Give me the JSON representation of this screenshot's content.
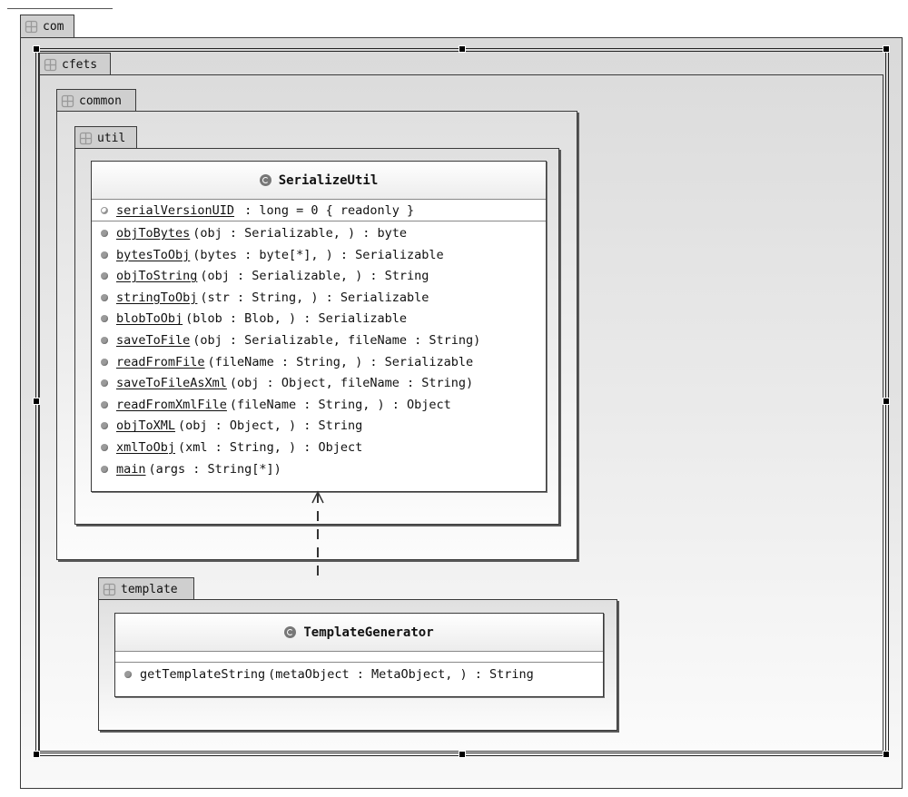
{
  "diagram": {
    "type": "UML package/class diagram",
    "packages": [
      {
        "id": "com",
        "label": "com",
        "icon": "package-icon"
      },
      {
        "id": "cfets",
        "label": "cfets",
        "icon": "package-icon",
        "selected": true
      },
      {
        "id": "common",
        "label": "common",
        "icon": "package-icon"
      },
      {
        "id": "util",
        "label": "util",
        "icon": "package-icon"
      },
      {
        "id": "template",
        "label": "template",
        "icon": "package-icon"
      }
    ],
    "classes": {
      "serialize_util": {
        "name": "SerializeUtil",
        "icon": "class-icon",
        "attributes": [
          {
            "name": "serialVersionUID",
            "signature": " : long = 0 { readonly }",
            "static": true,
            "visibility": "private-icon"
          }
        ],
        "operations": [
          {
            "name": "objToBytes",
            "signature": "(obj : Serializable, ) : byte",
            "static": true
          },
          {
            "name": "bytesToObj",
            "signature": "(bytes : byte[*], ) : Serializable",
            "static": true
          },
          {
            "name": "objToString",
            "signature": "(obj : Serializable, ) : String",
            "static": true
          },
          {
            "name": "stringToObj",
            "signature": "(str : String, ) : Serializable",
            "static": true
          },
          {
            "name": "blobToObj",
            "signature": "(blob : Blob, ) : Serializable",
            "static": true
          },
          {
            "name": "saveToFile",
            "signature": "(obj : Serializable, fileName : String)",
            "static": true
          },
          {
            "name": "readFromFile",
            "signature": "(fileName : String, ) : Serializable",
            "static": true
          },
          {
            "name": "saveToFileAsXml",
            "signature": "(obj : Object, fileName : String)",
            "static": true
          },
          {
            "name": "readFromXmlFile",
            "signature": "(fileName : String, ) : Object",
            "static": true
          },
          {
            "name": "objToXML",
            "signature": "(obj : Object, ) : String",
            "static": true
          },
          {
            "name": "xmlToObj",
            "signature": "(xml : String, ) : Object",
            "static": true
          },
          {
            "name": "main",
            "signature": "(args : String[*])",
            "static": true
          }
        ]
      },
      "template_generator": {
        "name": "TemplateGenerator",
        "icon": "class-icon",
        "attributes": [],
        "operations": [
          {
            "name": "getTemplateString",
            "signature": "(metaObject : MetaObject, ) : String",
            "static": false
          }
        ]
      }
    },
    "relationships": [
      {
        "type": "dependency",
        "from": "TemplateGenerator",
        "to": "SerializeUtil",
        "style": "dashed-open-arrow"
      }
    ]
  }
}
